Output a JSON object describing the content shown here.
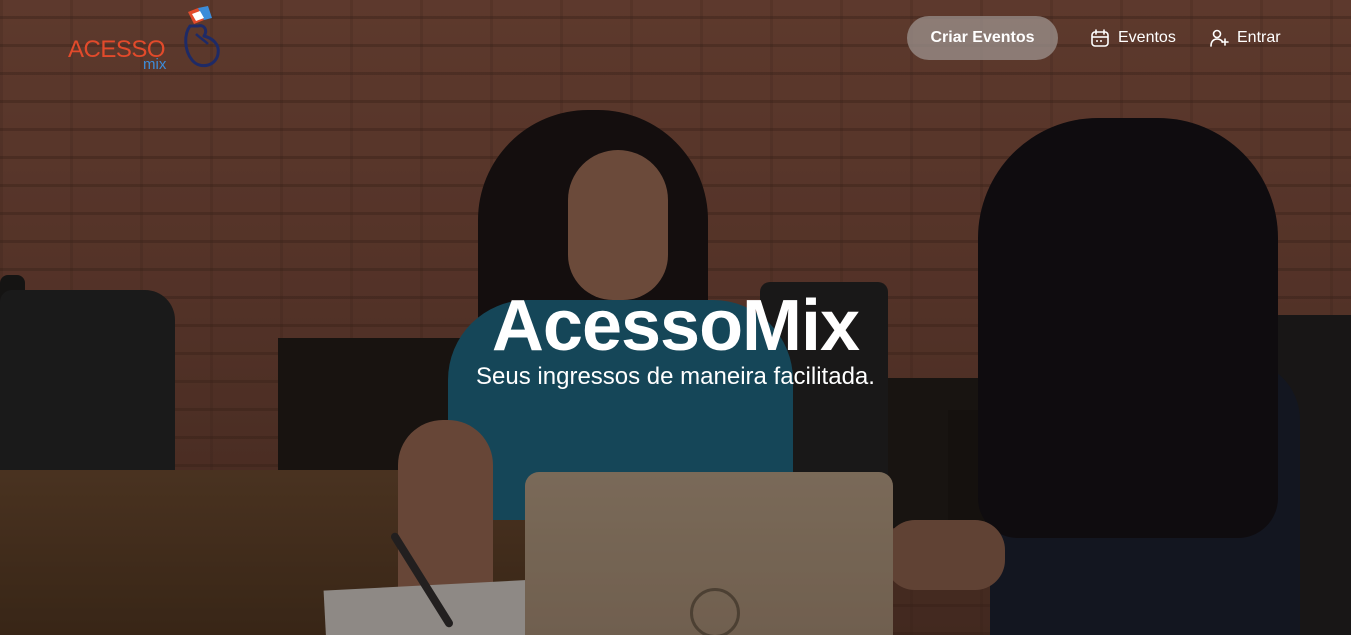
{
  "header": {
    "logo": {
      "primary_text": "ACESSO",
      "secondary_text": "mix",
      "primary_color": "#e24a2b",
      "secondary_color": "#3c8cd9",
      "icon": "heart-hand-icon"
    },
    "nav": {
      "create_events_label": "Criar Eventos",
      "events_label": "Eventos",
      "events_icon": "calendar-icon",
      "login_label": "Entrar",
      "login_icon": "user-plus-icon"
    }
  },
  "hero": {
    "title": "AcessoMix",
    "subtitle": "Seus ingressos de maneira facilitada.",
    "background_image": "office-meeting-photo"
  },
  "colors": {
    "text": "#ffffff",
    "button_background": "#a0968f"
  }
}
